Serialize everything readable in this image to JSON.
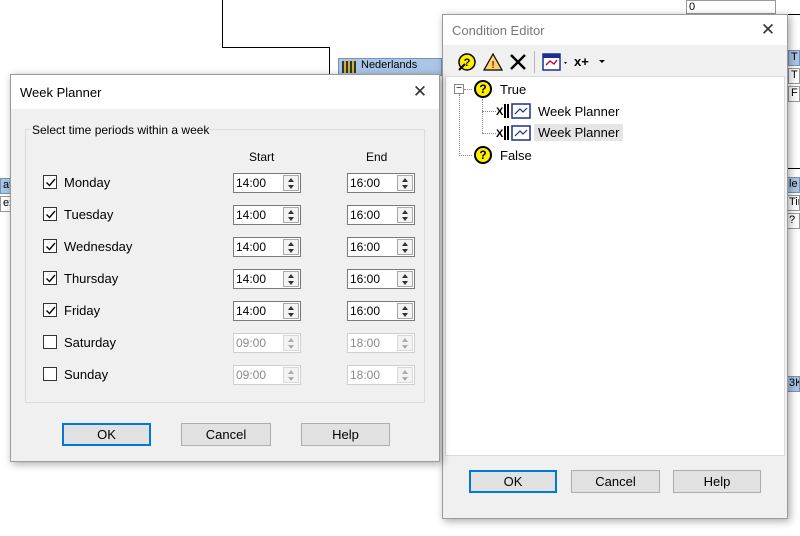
{
  "background": {
    "node_nederlands": "Nederlands",
    "left_fragments": [
      "at",
      "ex"
    ],
    "right_fragments": [
      "0",
      "T",
      "T",
      "F",
      "le",
      "Tim",
      "?",
      "3K"
    ]
  },
  "week_planner": {
    "title": "Week Planner",
    "group_title": "Select time periods within a week",
    "col_start": "Start",
    "col_end": "End",
    "days": [
      {
        "label": "Monday",
        "checked": true,
        "start": "14:00",
        "end": "16:00"
      },
      {
        "label": "Tuesday",
        "checked": true,
        "start": "14:00",
        "end": "16:00"
      },
      {
        "label": "Wednesday",
        "checked": true,
        "start": "14:00",
        "end": "16:00"
      },
      {
        "label": "Thursday",
        "checked": true,
        "start": "14:00",
        "end": "16:00"
      },
      {
        "label": "Friday",
        "checked": true,
        "start": "14:00",
        "end": "16:00"
      },
      {
        "label": "Saturday",
        "checked": false,
        "start": "09:00",
        "end": "18:00"
      },
      {
        "label": "Sunday",
        "checked": false,
        "start": "09:00",
        "end": "18:00"
      }
    ],
    "ok_label": "OK",
    "cancel_label": "Cancel",
    "help_label": "Help"
  },
  "condition_editor": {
    "title": "Condition Editor",
    "toolbar": {
      "icons": [
        "help-wizard-icon",
        "warning-icon",
        "delete-icon",
        "calendar-icon",
        "variable-icon"
      ],
      "var_label": "x+"
    },
    "tree": {
      "root_true": "True",
      "child1": "Week Planner",
      "child2": "Week Planner",
      "root_false": "False",
      "collapse_symbol": "−"
    },
    "ok_label": "OK",
    "cancel_label": "Cancel",
    "help_label": "Help"
  },
  "colors": {
    "accent": "#0078d7",
    "node_blue": "#aac6e6",
    "question_yellow": "#ffef00"
  }
}
